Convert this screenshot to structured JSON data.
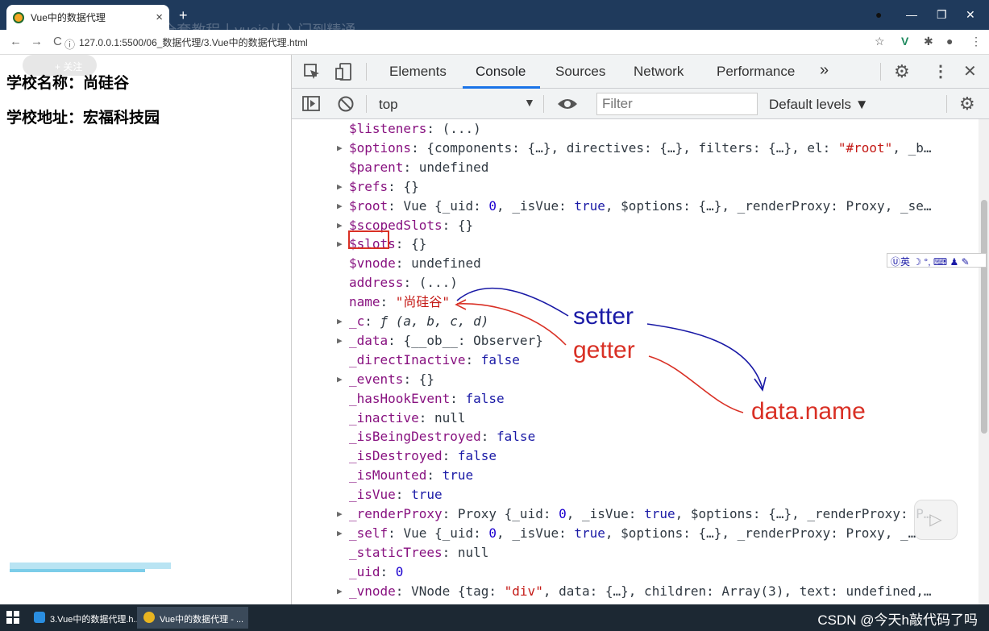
{
  "browser": {
    "tab_title": "Vue中的数据代理",
    "tab_close": "×",
    "new_tab": "+",
    "overlay_title": "尚硅谷Vue2.0+Vue3.0全套教程丨vuejs从入门到精通",
    "url": "127.0.0.1:5500/06_数据代理/3.Vue中的数据代理.html",
    "nav": {
      "back": "←",
      "forward": "→",
      "reload": "C",
      "info": "ⓘ"
    },
    "window": {
      "minimize": "—",
      "restore": "❐",
      "close": "✕",
      "record": "●"
    }
  },
  "page": {
    "watermark": "+ 关注",
    "school_name": "学校名称：尚硅谷",
    "school_address": "学校地址：宏福科技园"
  },
  "devtools": {
    "tabs": [
      "Elements",
      "Console",
      "Sources",
      "Network",
      "Performance",
      "»"
    ],
    "active_tab": "Console",
    "context": "top",
    "filter_placeholder": "Filter",
    "levels": "Default levels ▼",
    "console_lines": [
      {
        "tri": "",
        "key": "$listeners",
        "rest": [
          [
            "v",
            ": (...)"
          ]
        ]
      },
      {
        "tri": "▶",
        "key": "$options",
        "rest": [
          [
            "v",
            ": {components: {…}, directives: {…}, filters: {…}, el: "
          ],
          [
            "str",
            "\"#root\""
          ],
          [
            "v",
            ", _b…"
          ]
        ]
      },
      {
        "tri": "",
        "key": "$parent",
        "rest": [
          [
            "v",
            ": undefined"
          ]
        ]
      },
      {
        "tri": "▶",
        "key": "$refs",
        "rest": [
          [
            "v",
            ": {}"
          ]
        ]
      },
      {
        "tri": "▶",
        "key": "$root",
        "rest": [
          [
            "v",
            ": Vue {_uid: "
          ],
          [
            "num",
            "0"
          ],
          [
            "v",
            ", _isVue: "
          ],
          [
            "kw",
            "true"
          ],
          [
            "v",
            ", $options: {…}, _renderProxy: Proxy, _se…"
          ]
        ]
      },
      {
        "tri": "▶",
        "key": "$scopedSlots",
        "rest": [
          [
            "v",
            ": {}"
          ]
        ]
      },
      {
        "tri": "▶",
        "key": "$slots",
        "rest": [
          [
            "v",
            ": {}"
          ]
        ]
      },
      {
        "tri": "",
        "key": "$vnode",
        "rest": [
          [
            "v",
            ": undefined"
          ]
        ]
      },
      {
        "tri": "",
        "key": "address",
        "rest": [
          [
            "v",
            ": (...)"
          ]
        ]
      },
      {
        "tri": "",
        "key": "name",
        "rest": [
          [
            "v",
            ": "
          ],
          [
            "str",
            "\"尚硅谷\""
          ]
        ]
      },
      {
        "tri": "▶",
        "key": "_c",
        "rest": [
          [
            "v",
            ": "
          ],
          [
            "fn",
            "ƒ (a, b, c, d)"
          ]
        ]
      },
      {
        "tri": "▶",
        "key": "_data",
        "rest": [
          [
            "v",
            ": {__ob__: Observer}"
          ]
        ]
      },
      {
        "tri": "",
        "key": "_directInactive",
        "rest": [
          [
            "v",
            ": "
          ],
          [
            "kw",
            "false"
          ]
        ]
      },
      {
        "tri": "▶",
        "key": "_events",
        "rest": [
          [
            "v",
            ": {}"
          ]
        ]
      },
      {
        "tri": "",
        "key": "_hasHookEvent",
        "rest": [
          [
            "v",
            ": "
          ],
          [
            "kw",
            "false"
          ]
        ]
      },
      {
        "tri": "",
        "key": "_inactive",
        "rest": [
          [
            "v",
            ": null"
          ]
        ]
      },
      {
        "tri": "",
        "key": "_isBeingDestroyed",
        "rest": [
          [
            "v",
            ": "
          ],
          [
            "kw",
            "false"
          ]
        ]
      },
      {
        "tri": "",
        "key": "_isDestroyed",
        "rest": [
          [
            "v",
            ": "
          ],
          [
            "kw",
            "false"
          ]
        ]
      },
      {
        "tri": "",
        "key": "_isMounted",
        "rest": [
          [
            "v",
            ": "
          ],
          [
            "kw",
            "true"
          ]
        ]
      },
      {
        "tri": "",
        "key": "_isVue",
        "rest": [
          [
            "v",
            ": "
          ],
          [
            "kw",
            "true"
          ]
        ]
      },
      {
        "tri": "▶",
        "key": "_renderProxy",
        "rest": [
          [
            "v",
            ": Proxy {_uid: "
          ],
          [
            "num",
            "0"
          ],
          [
            "v",
            ", _isVue: "
          ],
          [
            "kw",
            "true"
          ],
          [
            "v",
            ", $options: {…}, _renderProxy: P…"
          ]
        ]
      },
      {
        "tri": "▶",
        "key": "_self",
        "rest": [
          [
            "v",
            ": Vue {_uid: "
          ],
          [
            "num",
            "0"
          ],
          [
            "v",
            ", _isVue: "
          ],
          [
            "kw",
            "true"
          ],
          [
            "v",
            ", $options: {…}, _renderProxy: Proxy, _…"
          ]
        ]
      },
      {
        "tri": "",
        "key": "_staticTrees",
        "rest": [
          [
            "v",
            ": null"
          ]
        ]
      },
      {
        "tri": "",
        "key": "_uid",
        "rest": [
          [
            "v",
            ": "
          ],
          [
            "num",
            "0"
          ]
        ]
      },
      {
        "tri": "▶",
        "key": "_vnode",
        "rest": [
          [
            "v",
            ": VNode {tag: "
          ],
          [
            "str",
            "\"div\""
          ],
          [
            "v",
            ", data: {…}, children: Array(3), text: undefined,…"
          ]
        ]
      }
    ]
  },
  "annotations": {
    "setter": "setter",
    "getter": "getter",
    "data_name": "data.name",
    "setter_color": "#1a1aa6",
    "getter_color": "#d93025"
  },
  "ime": "Ⓤ英 ☽ °, ⌨ ♟ ✎",
  "taskbar": {
    "item1": "3.Vue中的数据代理.h...",
    "item2": "Vue中的数据代理 - ...",
    "watermark": "CSDN @今天h敲代码了吗"
  }
}
